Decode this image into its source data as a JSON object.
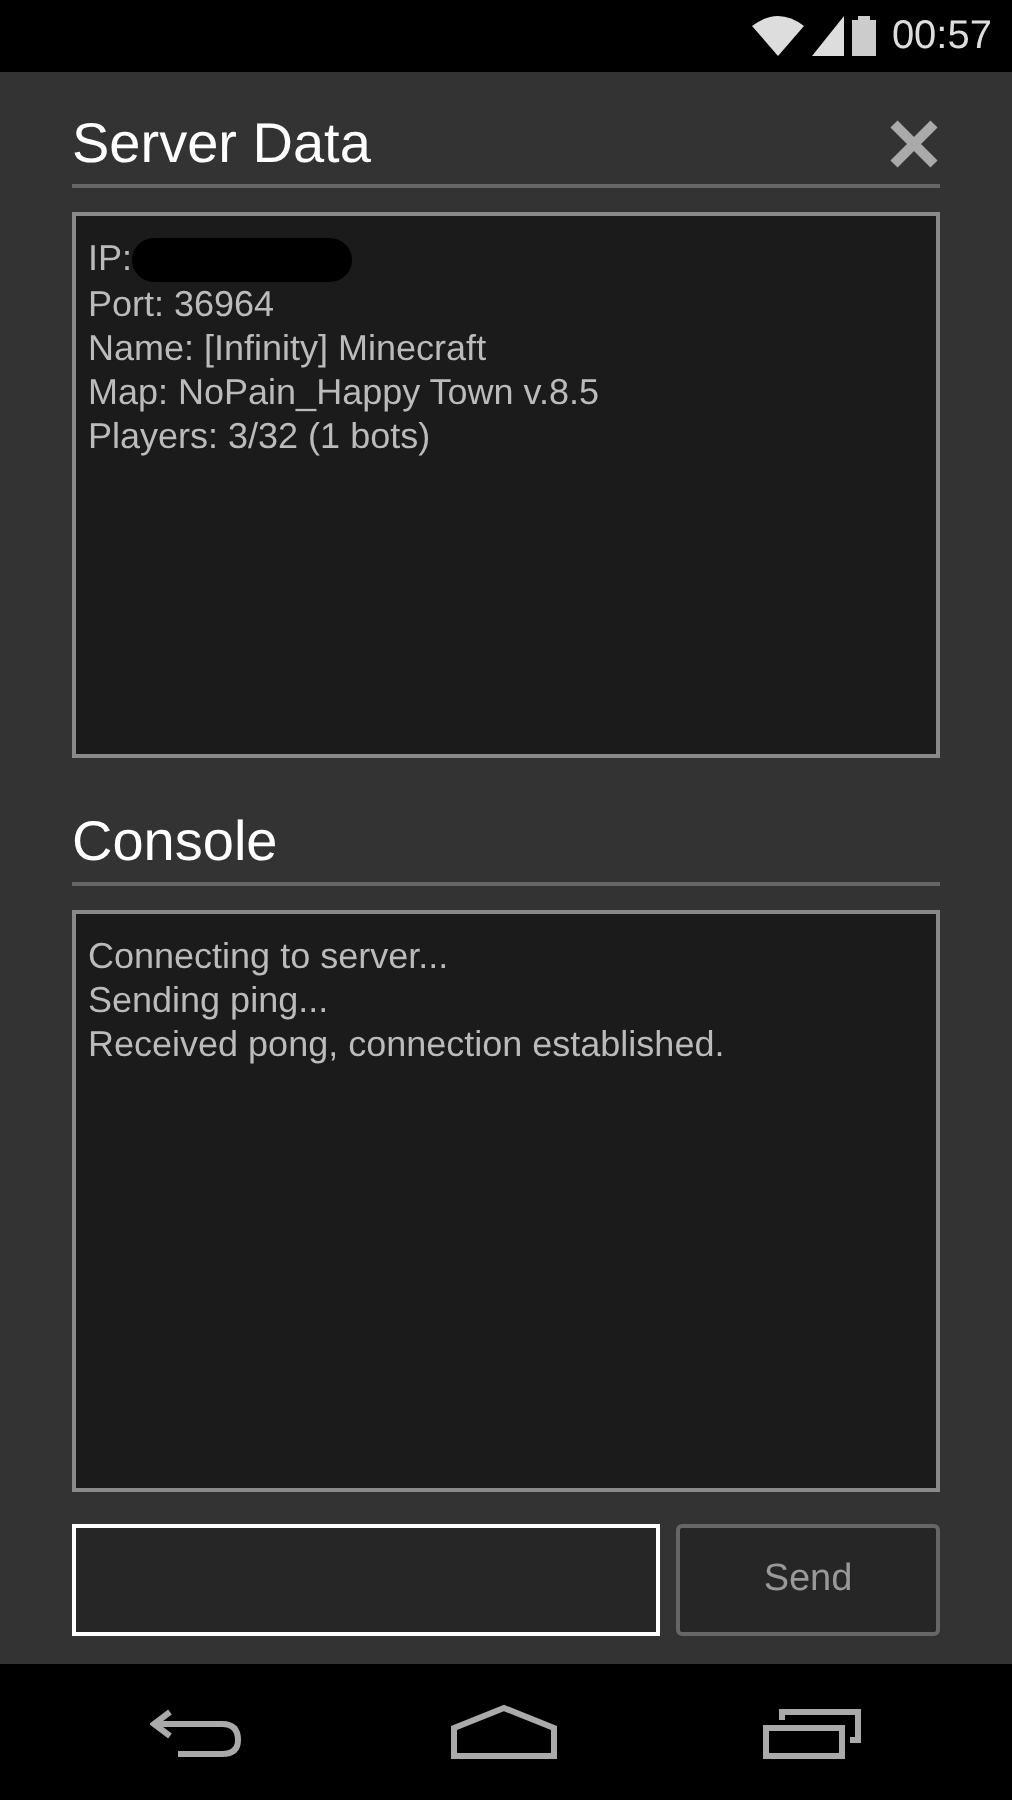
{
  "status_bar": {
    "time": "00:57"
  },
  "server_data": {
    "title": "Server Data",
    "lines": [
      {
        "text": "IP:",
        "redacted": true
      },
      {
        "text": "Port: 36964",
        "redacted": false
      },
      {
        "text": "Name: [Infinity] Minecraft",
        "redacted": false
      },
      {
        "text": "Map: NoPain_Happy Town v.8.5",
        "redacted": false
      },
      {
        "text": "Players: 3/32 (1 bots)",
        "redacted": false
      }
    ]
  },
  "console": {
    "title": "Console",
    "lines": [
      "Connecting to server...",
      "Sending ping...",
      "Received pong, connection established."
    ]
  },
  "input": {
    "focused": true
  },
  "send_button": {
    "label": "Send"
  }
}
